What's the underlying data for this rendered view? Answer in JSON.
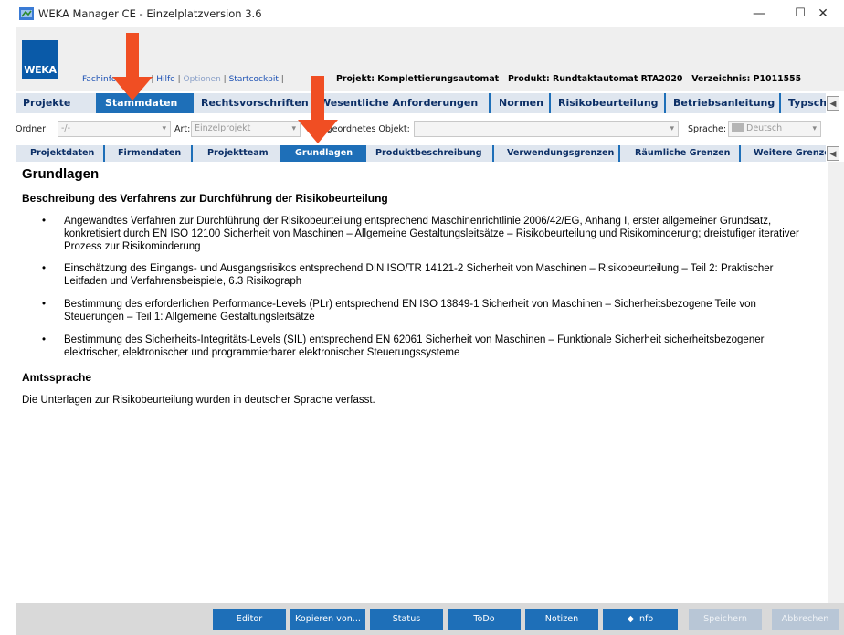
{
  "window": {
    "title": "WEKA Manager CE - Einzelplatzversion 3.6",
    "minimize": "—",
    "maximize": "☐",
    "close": "✕"
  },
  "header": {
    "logo": "WEKA",
    "links": [
      {
        "label": "Fachinformation",
        "enabled": true
      },
      {
        "label": "Hilfe",
        "enabled": true
      },
      {
        "label": "Optionen",
        "enabled": false
      },
      {
        "label": "Startcockpit",
        "enabled": true
      }
    ],
    "projekt_label": "Projekt:",
    "projekt": "Komplettierungsautomat",
    "produkt_label": "Produkt:",
    "produkt": "Rundtaktautomat RTA2020",
    "verzeichnis_label": "Verzeichnis:",
    "verzeichnis": "P1011555"
  },
  "main_tabs": [
    {
      "label": "Projekte",
      "active": false
    },
    {
      "label": "Stammdaten",
      "active": true
    },
    {
      "label": "Rechtsvorschriften",
      "active": false
    },
    {
      "label": "Wesentliche Anforderungen",
      "active": false
    },
    {
      "label": "Normen",
      "active": false
    },
    {
      "label": "Risikobeurteilung",
      "active": false
    },
    {
      "label": "Betriebsanleitung",
      "active": false
    },
    {
      "label": "Typschild",
      "active": false
    }
  ],
  "filters": {
    "ordner_label": "Ordner:",
    "ordner_value": "-/-",
    "art_label": "Art:",
    "art_value": "Einzelprojekt",
    "objekt_label": "Übergeordnetes Objekt:",
    "objekt_value": "",
    "sprache_label": "Sprache:",
    "sprache_value": "Deutsch"
  },
  "sub_tabs": [
    {
      "label": "Projektdaten",
      "active": false
    },
    {
      "label": "Firmendaten",
      "active": false
    },
    {
      "label": "Projektteam",
      "active": false
    },
    {
      "label": "Grundlagen",
      "active": true
    },
    {
      "label": "Produktbeschreibung",
      "active": false
    },
    {
      "label": "Verwendungsgrenzen",
      "active": false
    },
    {
      "label": "Räumliche Grenzen",
      "active": false
    },
    {
      "label": "Weitere Grenzen",
      "active": false
    }
  ],
  "content": {
    "heading": "Grundlagen",
    "section_title": "Beschreibung des Verfahrens zur Durchführung der Risikobeurteilung",
    "items": [
      "Angewandtes Verfahren zur Durchführung der Risikobeurteilung entsprechend Maschinenrichtlinie 2006/42/EG, Anhang I, erster allgemeiner Grundsatz, konkretisiert durch EN ISO 12100 Sicherheit von Maschinen – Allgemeine Gestaltungsleitsätze – Risikobeurteilung und Risikominderung; dreistufiger iterativer Prozess zur Risikominderung",
      "Einschätzung des Eingangs- und Ausgangsrisikos entsprechend DIN ISO/TR 14121-2 Sicherheit von Maschinen – Risikobeurteilung – Teil 2: Praktischer Leitfaden und Verfahrensbeispiele, 6.3 Risikograph",
      "Bestimmung des erforderlichen Performance-Levels (PLr) entsprechend EN ISO 13849-1 Sicherheit von Maschinen – Sicherheitsbezogene Teile von Steuerungen – Teil 1: Allgemeine Gestaltungsleitsätze",
      "Bestimmung des Sicherheits-Integritäts-Levels (SIL) entsprechend EN 62061 Sicherheit von Maschinen – Funktionale Sicherheit sicherheitsbezogener elektrischer, elektronischer und programmierbarer elektronischer Steuerungssysteme"
    ],
    "bullet": "•",
    "section2_title": "Amtssprache",
    "section2_text": "Die Unterlagen zur Risikobeurteilung wurden in deutscher Sprache verfasst."
  },
  "buttons": {
    "editor": "Editor",
    "kopieren": "Kopieren von...",
    "status": "Status",
    "todo": "ToDo",
    "notizen": "Notizen",
    "info": "Info",
    "speichern": "Speichern",
    "abbrechen": "Abbrechen"
  },
  "colors": {
    "accent": "#1e6fb8",
    "tab_inactive": "#dfe6ef",
    "arrow": "#f04e23",
    "logo": "#0a5aa8"
  }
}
